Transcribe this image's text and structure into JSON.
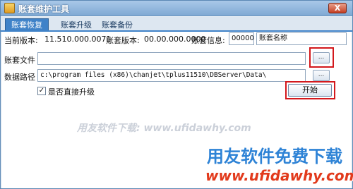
{
  "window": {
    "title": "账套维护工具",
    "close_label": "X"
  },
  "tabs": [
    {
      "label": "账套恢复",
      "active": true
    },
    {
      "label": "账套升级",
      "active": false
    },
    {
      "label": "账套备份",
      "active": false
    }
  ],
  "info": {
    "current_version_label": "当前版本:",
    "current_version_value": "11.510.000.0071",
    "account_version_label": "账套版本:",
    "account_version_value": "00.00.000.0000",
    "account_info_label": "账套信息:",
    "account_code_value": "000000",
    "account_name_value": "账套名称"
  },
  "account_file": {
    "label": "账套文件",
    "value": "",
    "browse_label": "..."
  },
  "data_path": {
    "label": "数据路径",
    "value": "c:\\program files (x86)\\chanjet\\tplus11510\\DBServer\\Data\\",
    "browse_label": "..."
  },
  "direct_upgrade": {
    "label": "是否直接升级",
    "checked": true,
    "check_glyph": "✓"
  },
  "start_button": {
    "label": "开始"
  },
  "watermarks": {
    "center": "用友软件下载: www.ufidawhy.com",
    "brand": "用友软件免费下载",
    "url": "www.ufidawhy.com"
  },
  "colors": {
    "accent": "#3f82c8",
    "highlight": "#d3181c",
    "watermark_brand": "#2e83d6",
    "watermark_url": "#e23a1c"
  }
}
